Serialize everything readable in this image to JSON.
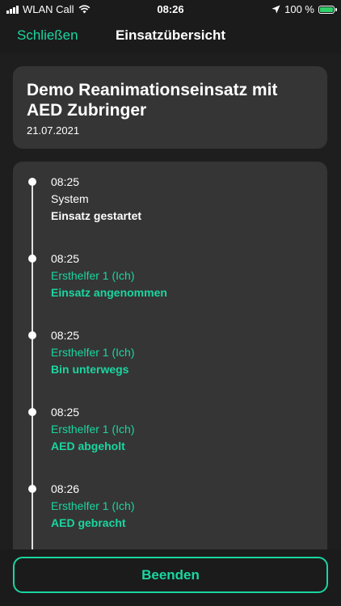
{
  "status_bar": {
    "carrier": "WLAN Call",
    "time": "08:26",
    "battery_percent": "100 %",
    "icons": [
      "signal-icon",
      "wifi-icon",
      "location-arrow-icon",
      "battery-charging-icon"
    ]
  },
  "nav": {
    "close_label": "Schließen",
    "title": "Einsatzübersicht"
  },
  "mission": {
    "title": "Demo Reanimationseinsatz mit AED Zubringer",
    "date": "21.07.2021"
  },
  "timeline": [
    {
      "time": "08:25",
      "actor": "System",
      "action": "Einsatz gestartet",
      "type": "system"
    },
    {
      "time": "08:25",
      "actor": "Ersthelfer 1 (Ich)",
      "action": "Einsatz angenommen",
      "type": "helper"
    },
    {
      "time": "08:25",
      "actor": "Ersthelfer 1 (Ich)",
      "action": "Bin unterwegs",
      "type": "helper"
    },
    {
      "time": "08:25",
      "actor": "Ersthelfer 1 (Ich)",
      "action": "AED abgeholt",
      "type": "helper"
    },
    {
      "time": "08:26",
      "actor": "Ersthelfer 1 (Ich)",
      "action": "AED gebracht",
      "type": "helper"
    }
  ],
  "footer": {
    "finish_label": "Beenden"
  },
  "colors": {
    "accent": "#1ad6a0",
    "card": "#353535",
    "background": "#1b1b1b",
    "battery": "#2fd06a"
  }
}
